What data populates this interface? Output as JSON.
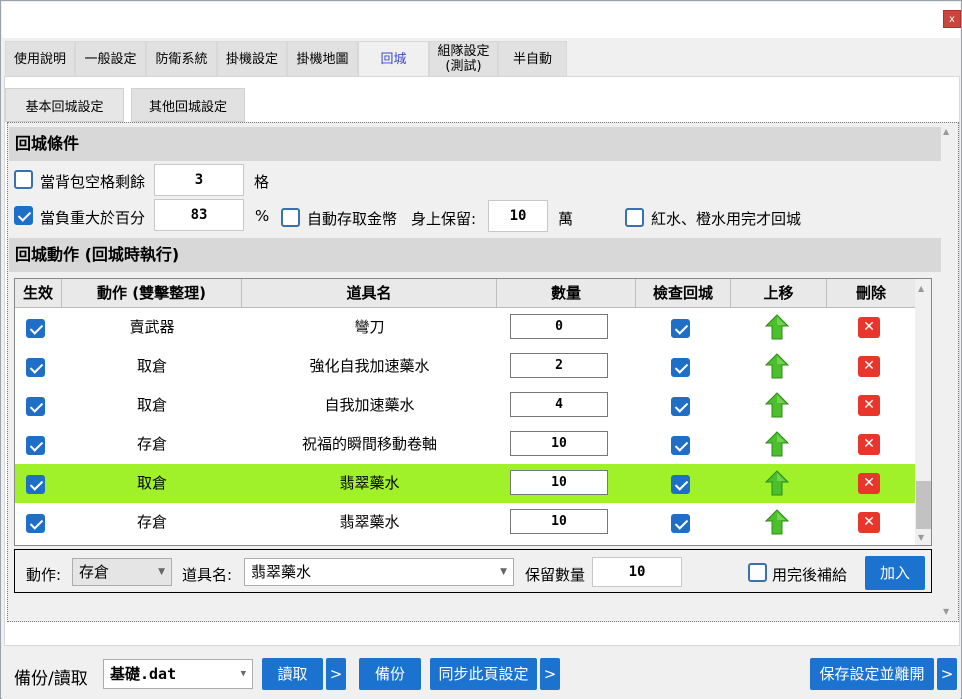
{
  "window": {
    "close_label": "x"
  },
  "tabs": [
    {
      "label": "使用說明"
    },
    {
      "label": "一般設定"
    },
    {
      "label": "防衛系統"
    },
    {
      "label": "掛機設定"
    },
    {
      "label": "掛機地圖"
    },
    {
      "label": "回城"
    },
    {
      "label": "組隊設定\n(測試)"
    },
    {
      "label": "半自動"
    }
  ],
  "active_tab": "回城",
  "subtabs": [
    {
      "label": "基本回城設定"
    },
    {
      "label": "其他回城設定"
    }
  ],
  "conditions": {
    "section_title": "回城條件",
    "bag_check": {
      "checked": false,
      "label": "當背包空格剩餘",
      "value": "3",
      "unit": "格"
    },
    "weight_check": {
      "checked": true,
      "label": "當負重大於百分",
      "value": "83",
      "unit": "%"
    },
    "auto_gold": {
      "checked": false,
      "label": "自動存取金幣",
      "keep_label": "身上保留:",
      "value": "10",
      "unit": "萬"
    },
    "potion_check": {
      "checked": false,
      "label": "紅水、橙水用完才回城"
    }
  },
  "actions": {
    "section_title": "回城動作 (回城時執行)",
    "columns": [
      "生效",
      "動作 (雙擊整理)",
      "道具名",
      "數量",
      "檢查回城",
      "上移",
      "刪除"
    ],
    "rows": [
      {
        "enabled": true,
        "action": "賣武器",
        "item": "彎刀",
        "qty": "0",
        "check": true,
        "highlight": false
      },
      {
        "enabled": true,
        "action": "取倉",
        "item": "強化自我加速藥水",
        "qty": "2",
        "check": true,
        "highlight": false
      },
      {
        "enabled": true,
        "action": "取倉",
        "item": "自我加速藥水",
        "qty": "4",
        "check": true,
        "highlight": false
      },
      {
        "enabled": true,
        "action": "存倉",
        "item": "祝福的瞬間移動卷軸",
        "qty": "10",
        "check": true,
        "highlight": false
      },
      {
        "enabled": true,
        "action": "取倉",
        "item": "翡翠藥水",
        "qty": "10",
        "check": true,
        "highlight": true
      },
      {
        "enabled": true,
        "action": "存倉",
        "item": "翡翠藥水",
        "qty": "10",
        "check": true,
        "highlight": false
      }
    ],
    "delete_glyph": "✕"
  },
  "add_bar": {
    "action_label": "動作:",
    "action_value": "存倉",
    "item_label": "道具名:",
    "item_value": "翡翠藥水",
    "keep_label": "保留數量",
    "keep_value": "10",
    "refill_label": "用完後補給",
    "refill_checked": false,
    "add_button": "加入"
  },
  "footer": {
    "backup_label": "備份/讀取",
    "file_value": "基礎.dat",
    "read_button": "讀取",
    "more_glyph": ">",
    "backup_button": "備份",
    "sync_button": "同步此頁設定",
    "save_button": "保存設定並離開"
  },
  "colors": {
    "accent": "#1b72cf",
    "highlight_row": "#a0f02a",
    "delete": "#e8362c",
    "arrow": "#4bbf2c",
    "active_tab_text": "#3b49c8"
  }
}
